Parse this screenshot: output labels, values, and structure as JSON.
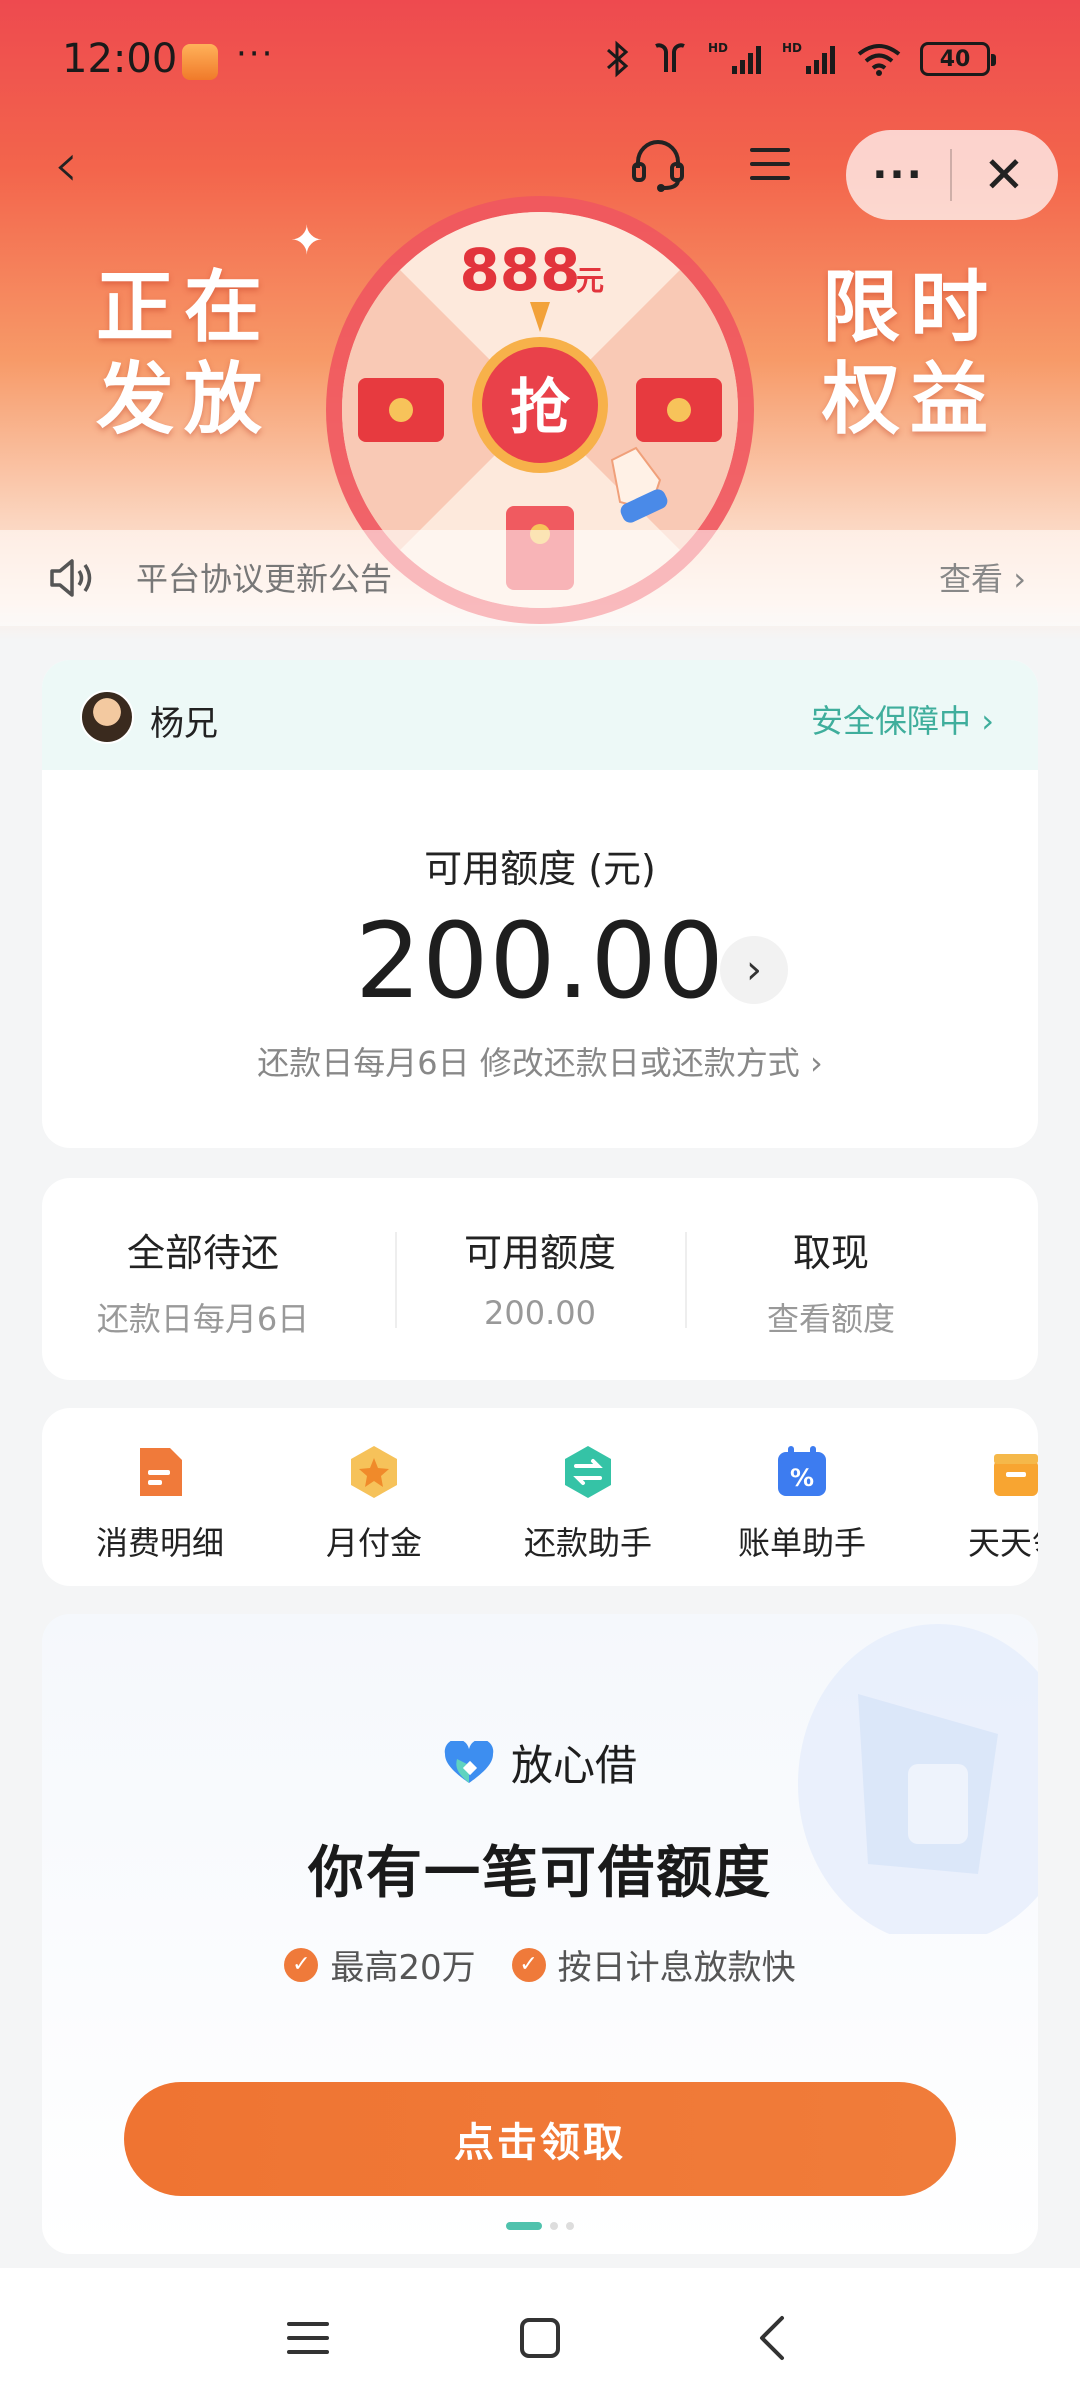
{
  "status_bar": {
    "time": "12:00",
    "more": "···",
    "battery": "40"
  },
  "top_bar": {
    "more_label": "···",
    "close_label": "✕"
  },
  "banner": {
    "left_line1": "正在",
    "left_line2": "发放",
    "right_line1": "限时",
    "right_line2": "权益",
    "wheel_amount": "888",
    "wheel_unit": "元",
    "wheel_center": "抢"
  },
  "notice": {
    "text": "平台协议更新公告",
    "link": "查看 ›"
  },
  "account": {
    "user_name": "杨兄",
    "security_label": "安全保障中 ›",
    "credit_label": "可用额度 (元)",
    "credit_amount": "200.00",
    "repay_note": "还款日每月6日  修改还款日或还款方式 ›"
  },
  "stats": [
    {
      "title": "全部待还",
      "sub": "还款日每月6日"
    },
    {
      "title": "可用额度",
      "sub": "200.00"
    },
    {
      "title": "取现",
      "sub": "查看额度"
    }
  ],
  "shortcuts": [
    {
      "label": "消费明细",
      "icon": "document-icon"
    },
    {
      "label": "月付金",
      "icon": "star-badge-icon"
    },
    {
      "label": "还款助手",
      "icon": "exchange-icon"
    },
    {
      "label": "账单助手",
      "icon": "calendar-percent-icon"
    },
    {
      "label": "天天领",
      "icon": "gift-icon"
    }
  ],
  "loan": {
    "brand": "放心借",
    "headline": "你有一笔可借额度",
    "feature1": "最高20万",
    "feature2": "按日计息放款快",
    "button": "点击领取"
  },
  "colors": {
    "banner_red": "#ee4a4f",
    "accent_orange": "#ef7432",
    "security_green": "#3fae9c",
    "page_bg": "#f4f5f6"
  }
}
